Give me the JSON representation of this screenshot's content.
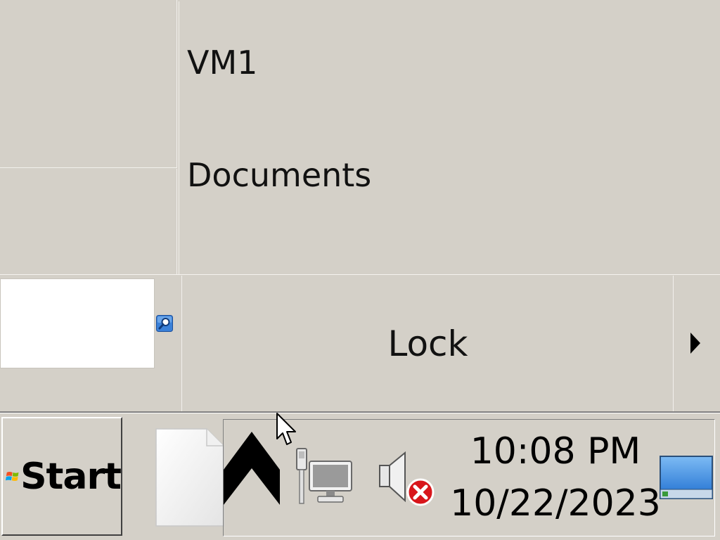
{
  "start_menu": {
    "links": [
      {
        "label": "VM1"
      },
      {
        "label": "Documents"
      }
    ],
    "search": {
      "value": "",
      "placeholder": ""
    },
    "power": {
      "label": "Lock"
    }
  },
  "taskbar": {
    "start_label": "Start",
    "clock": {
      "time": "10:08 PM",
      "date": "10/22/2023"
    }
  },
  "icons": {
    "search": "search-icon",
    "start_flag": "windows-flag-icon",
    "document": "document-icon",
    "tray_expand": "chevron-up-icon",
    "network": "network-disconnected-icon",
    "volume": "volume-muted-icon",
    "show_desktop": "show-desktop-icon",
    "lock_arrow": "arrow-right-icon",
    "cursor": "mouse-cursor-icon"
  },
  "colors": {
    "panel": "#d4d0c8",
    "highlight": "#ffffff",
    "shadow": "#808080",
    "accent_blue": "#2b7bd8",
    "error_red": "#d8161b"
  }
}
